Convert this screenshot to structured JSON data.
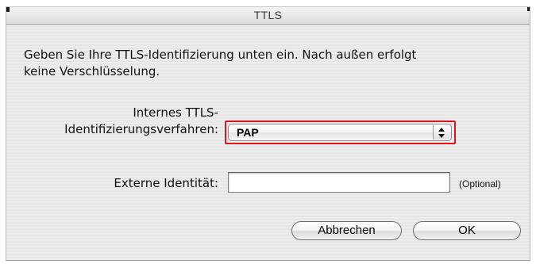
{
  "window": {
    "title": "TTLS"
  },
  "dialog": {
    "message_line1": "Geben Sie Ihre TTLS-Identifizierung unten ein. Nach außen erfolgt",
    "message_line2": "keine Verschlüsselung.",
    "method_label_line1": "Internes TTLS-",
    "method_label_line2": "Identifizierungsverfahren:",
    "method_selected": "PAP",
    "external_identity_label": "Externe Identität:",
    "external_identity_value": "",
    "optional_hint": "(Optional)"
  },
  "buttons": {
    "cancel_label": "Abbrechen",
    "ok_label": "OK"
  },
  "colors": {
    "focus_ring": "#e0141d",
    "window_background": "#e9e9e9"
  },
  "icons": {
    "popup_arrows": "up-down-arrows-icon"
  }
}
